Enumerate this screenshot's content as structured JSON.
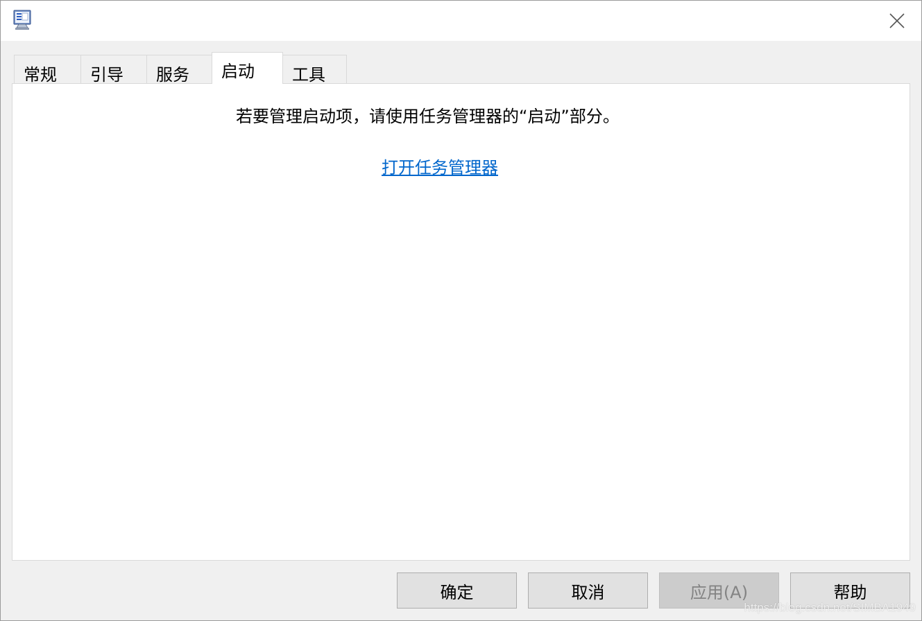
{
  "window": {
    "icon": "system-config-icon",
    "close_icon": "close-icon"
  },
  "tabs": [
    {
      "label": "常规"
    },
    {
      "label": "引导"
    },
    {
      "label": "服务"
    },
    {
      "label": "启动",
      "active": true
    },
    {
      "label": "工具"
    }
  ],
  "panel": {
    "hint_text": "若要管理启动项，请使用任务管理器的“启动”部分。",
    "link_text": "打开任务管理器"
  },
  "buttons": {
    "ok": "确定",
    "cancel": "取消",
    "apply": "应用(A)",
    "help": "帮助"
  },
  "watermark": "https://blog.csdn.net/SIMBA1949",
  "colors": {
    "link": "#0066cc",
    "chrome": "#f0f0f0",
    "button_face": "#e1e1e1"
  }
}
